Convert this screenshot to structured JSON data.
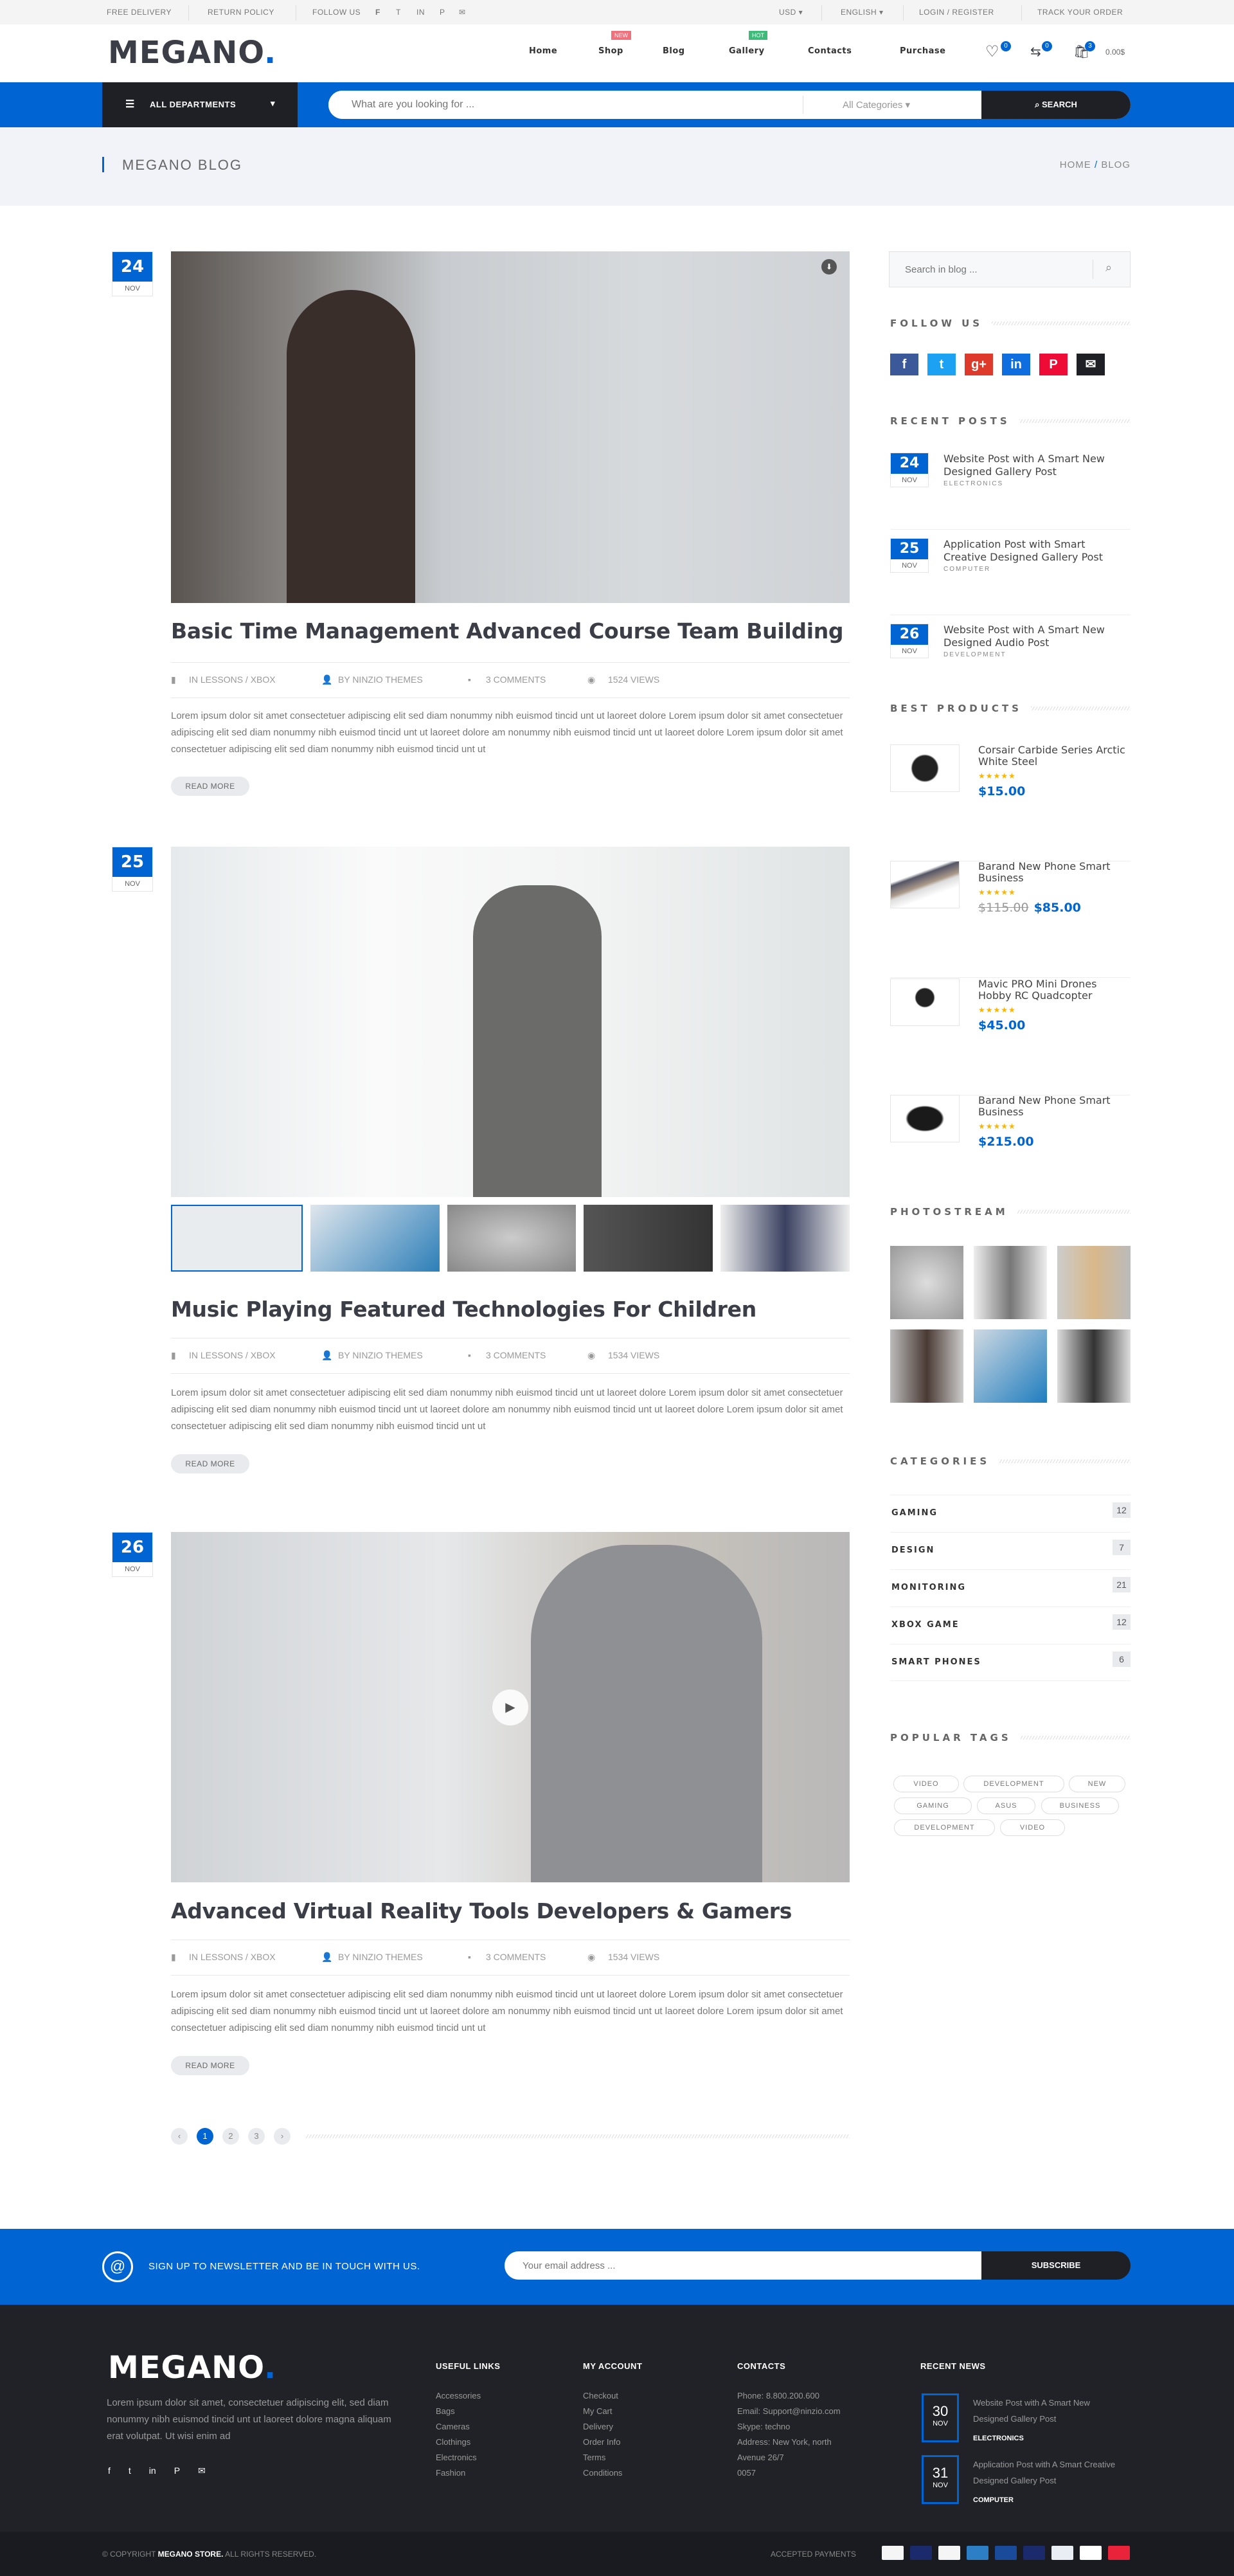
{
  "topbar": {
    "free_delivery": "Free Delivery",
    "return_policy": "Return Policy",
    "follow_us": "Follow Us",
    "currency": "USD",
    "language": "English",
    "login": "Login / Register",
    "track": "Track Your Order"
  },
  "header": {
    "logo": "MEGANO",
    "nav": [
      {
        "label": "Home"
      },
      {
        "label": "Shop",
        "badge": "NEW"
      },
      {
        "label": "Blog"
      },
      {
        "label": "Gallery",
        "badge": "HOT"
      },
      {
        "label": "Contacts"
      },
      {
        "label": "Purchase"
      }
    ],
    "wishlist_count": "0",
    "compare_count": "0",
    "cart_count": "3",
    "cart_total": "0.00$"
  },
  "searchbar": {
    "departments": "All Departments",
    "placeholder": "What are you looking for ...",
    "category": "All Categories",
    "button": "Search"
  },
  "breadcrumb": {
    "title": "Megano Blog",
    "home": "Home",
    "current": "Blog"
  },
  "posts": [
    {
      "day": "24",
      "month": "NOV",
      "title": "Basic Time Management Advanced Course Team Building",
      "category": "In Lessons / Xbox",
      "author": "By Ninzio Themes",
      "comments": "3 Comments",
      "views": "1524 Views",
      "excerpt": "Lorem ipsum dolor sit amet consectetuer adipiscing elit sed diam nonummy nibh euismod tincid  unt ut laoreet dolore Lorem ipsum dolor sit amet consectetuer adipiscing elit sed diam nonummy nibh euismod tincid  unt ut laoreet dolore am nonummy nibh euismod tincid  unt ut laoreet dolore Lorem ipsum dolor sit amet consectetuer adipiscing elit sed diam nonummy nibh euismod tincid  unt ut",
      "read_more": "Read More"
    },
    {
      "day": "25",
      "month": "NOV",
      "title": "Music Playing Featured Technologies For Children",
      "category": "In Lessons / Xbox",
      "author": "By Ninzio Themes",
      "comments": "3 Comments",
      "views": "1534 Views",
      "excerpt": "Lorem ipsum dolor sit amet consectetuer adipiscing elit sed diam nonummy nibh euismod tincid  unt ut laoreet dolore Lorem ipsum dolor sit amet consectetuer adipiscing elit sed diam nonummy nibh euismod tincid  unt ut laoreet dolore am nonummy nibh euismod tincid  unt ut laoreet dolore Lorem ipsum dolor sit amet consectetuer adipiscing elit sed diam nonummy nibh euismod tincid  unt ut",
      "read_more": "Read More"
    },
    {
      "day": "26",
      "month": "NOV",
      "title": "Advanced Virtual Reality Tools Developers & Gamers",
      "category": "In Lessons / Xbox",
      "author": "By Ninzio Themes",
      "comments": "3 Comments",
      "views": "1534 Views",
      "excerpt": "Lorem ipsum dolor sit amet consectetuer adipiscing elit sed diam nonummy nibh euismod tincid  unt ut laoreet dolore Lorem ipsum dolor sit amet consectetuer adipiscing elit sed diam nonummy nibh euismod tincid  unt ut laoreet dolore am nonummy nibh euismod tincid  unt ut laoreet dolore Lorem ipsum dolor sit amet consectetuer adipiscing elit sed diam nonummy nibh euismod tincid  unt ut",
      "read_more": "Read More"
    }
  ],
  "pagination": {
    "pages": [
      "1",
      "2",
      "3"
    ],
    "current": "1",
    "prev": "‹",
    "next": "›"
  },
  "sidebar": {
    "search_placeholder": "Search in blog ...",
    "follow_title": "Follow Us",
    "social": [
      {
        "icon": "facebook",
        "glyph": "f",
        "color": "#3b5998"
      },
      {
        "icon": "twitter",
        "glyph": "t",
        "color": "#1da1f2"
      },
      {
        "icon": "google-plus",
        "glyph": "g+",
        "color": "#dd3a2c"
      },
      {
        "icon": "linkedin",
        "glyph": "in",
        "color": "#0e6ee0"
      },
      {
        "icon": "pinterest",
        "glyph": "P",
        "color": "#ee0b36"
      },
      {
        "icon": "email",
        "glyph": "✉",
        "color": "#1f2026"
      }
    ],
    "recent_title": "Recent Posts",
    "recent": [
      {
        "day": "24",
        "month": "NOV",
        "title": "Website Post with A Smart New Designed Gallery Post",
        "category": "Electronics"
      },
      {
        "day": "25",
        "month": "NOV",
        "title": "Application Post with Smart Creative Designed Gallery Post",
        "category": "Computer"
      },
      {
        "day": "26",
        "month": "NOV",
        "title": "Website Post with A Smart New Designed Audio Post",
        "category": "Development"
      }
    ],
    "products_title": "Best Products",
    "products": [
      {
        "name": "Corsair Carbide Series Arctic White Steel",
        "rating": 5,
        "old_price": "",
        "price": "$15.00"
      },
      {
        "name": "Barand New Phone Smart Business",
        "rating": 5,
        "old_price": "$115.00",
        "price": "$85.00"
      },
      {
        "name": "Mavic PRO Mini Drones Hobby RC Quadcopter",
        "rating": 5,
        "old_price": "",
        "price": "$45.00"
      },
      {
        "name": "Barand New Phone Smart Business",
        "rating": 5,
        "old_price": "",
        "price": "$215.00"
      }
    ],
    "photostream_title": "Photostream",
    "categories_title": "Categories",
    "categories": [
      {
        "name": "Gaming",
        "count": "12"
      },
      {
        "name": "Design",
        "count": "7"
      },
      {
        "name": "Monitoring",
        "count": "21"
      },
      {
        "name": "Xbox Game",
        "count": "12"
      },
      {
        "name": "Smart Phones",
        "count": "6"
      }
    ],
    "tags_title": "Popular Tags",
    "tags": [
      "Video",
      "Development",
      "New",
      "Gaming",
      "Asus",
      "Business",
      "Development",
      "Video"
    ]
  },
  "newsletter": {
    "text": "Sign up to Newsletter and be in touch with us.",
    "placeholder": "Your email address ...",
    "button": "Subscribe"
  },
  "footer": {
    "logo": "MEGANO",
    "about": "Lorem ipsum dolor sit amet, consectetuer adipiscing elit, sed diam nonummy nibh euismod tincid  unt ut laoreet dolore magna aliquam erat volutpat. Ut wisi enim ad",
    "useful_title": "Useful Links",
    "useful": [
      "Accessories",
      "Bags",
      "Cameras",
      "Clothings",
      "Electronics",
      "Fashion"
    ],
    "account_title": "My Account",
    "account": [
      "Checkout",
      "My Cart",
      "Delivery",
      "Order Info",
      "Terms",
      "Conditions"
    ],
    "contacts_title": "Contacts",
    "contacts": [
      "Phone: 8.800.200.600",
      "Email: Support@ninzio.com",
      "Skype: techno",
      "Address: New York, north",
      "Avenue 26/7",
      "0057"
    ],
    "news_title": "Recent News",
    "news": [
      {
        "day": "30",
        "month": "NOV",
        "title": "Website Post with A Smart New Designed Gallery Post",
        "category": "Electronics"
      },
      {
        "day": "31",
        "month": "NOV",
        "title": "Application Post with A Smart Creative Designed Gallery Post",
        "category": "Computer"
      }
    ],
    "copyright_prefix": "© Copyright",
    "copyright_brand": "Megano Store.",
    "copyright_suffix": "All Rights Reserved.",
    "payments_label": "Accepted Payments",
    "payments": [
      "visa",
      "mastercard",
      "paypal",
      "american-express",
      "visa-electron",
      "maestro",
      "jcb",
      "ideal",
      "dk"
    ]
  },
  "colors": {
    "accent": "#0064d2",
    "dark": "#1f2026",
    "star": "#fbb500",
    "badge_new": "#f0707c",
    "badge_hot": "#3dbb78"
  }
}
